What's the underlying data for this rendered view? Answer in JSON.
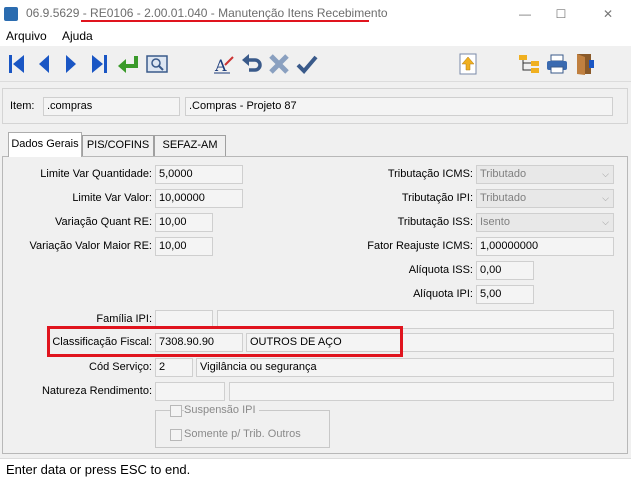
{
  "window": {
    "title": "06.9.5629 - RE0106 - 2.00.01.040 - Manutenção Itens Recebimento",
    "minimize": "—",
    "maximize": "☐",
    "close": "✕"
  },
  "menu": {
    "items": [
      "Arquivo",
      "Ajuda"
    ]
  },
  "toolbar": {
    "icons": [
      "first-icon",
      "prev-icon",
      "next-icon",
      "last-icon",
      "goto-icon",
      "search-icon",
      "edit-text-icon",
      "undo-icon",
      "cancel-icon",
      "confirm-icon",
      "upload-icon",
      "tree-icon",
      "print-icon",
      "exit-icon"
    ]
  },
  "item": {
    "label": "Item:",
    "code": ".compras",
    "description": ".Compras - Projeto 87"
  },
  "tabs": [
    "Dados Gerais",
    "PIS/COFINS",
    "SEFAZ-AM"
  ],
  "left_fields": [
    {
      "label": "Limite Var Quantidade:",
      "value": "5,0000"
    },
    {
      "label": "Limite Var Valor:",
      "value": "10,00000"
    },
    {
      "label": "Variação Quant RE:",
      "value": "10,00"
    },
    {
      "label": "Variação Valor Maior RE:",
      "value": "10,00"
    }
  ],
  "right_fields": {
    "trib_icms": {
      "label": "Tributação ICMS:",
      "value": "Tributado"
    },
    "trib_ipi": {
      "label": "Tributação IPI:",
      "value": "Tributado"
    },
    "trib_iss": {
      "label": "Tributação ISS:",
      "value": "Isento"
    },
    "fator": {
      "label": "Fator Reajuste ICMS:",
      "value": "1,00000000"
    },
    "aliq_iss": {
      "label": "Alíquota ISS:",
      "value": "0,00"
    },
    "aliq_ipi": {
      "label": "Alíquota IPI:",
      "value": "5,00"
    }
  },
  "familia_ipi": {
    "label": "Família IPI:",
    "code": "",
    "description": ""
  },
  "classificacao": {
    "label": "Classificação Fiscal:",
    "code": "7308.90.90",
    "description": "OUTROS DE AÇO"
  },
  "servico": {
    "label": "Cód Serviço:",
    "code": "2",
    "description": "Vigilância ou segurança"
  },
  "natureza": {
    "label": "Natureza Rendimento:",
    "code": "",
    "description": ""
  },
  "checkboxes": [
    {
      "label": "Suspensão IPI",
      "checked": false
    },
    {
      "label": "Somente p/ Trib. Outros",
      "checked": false
    }
  ],
  "status": "Enter data or press ESC to end.",
  "colors": {
    "highlight": "#e0141e",
    "nav_blue": "#1a56c4"
  }
}
